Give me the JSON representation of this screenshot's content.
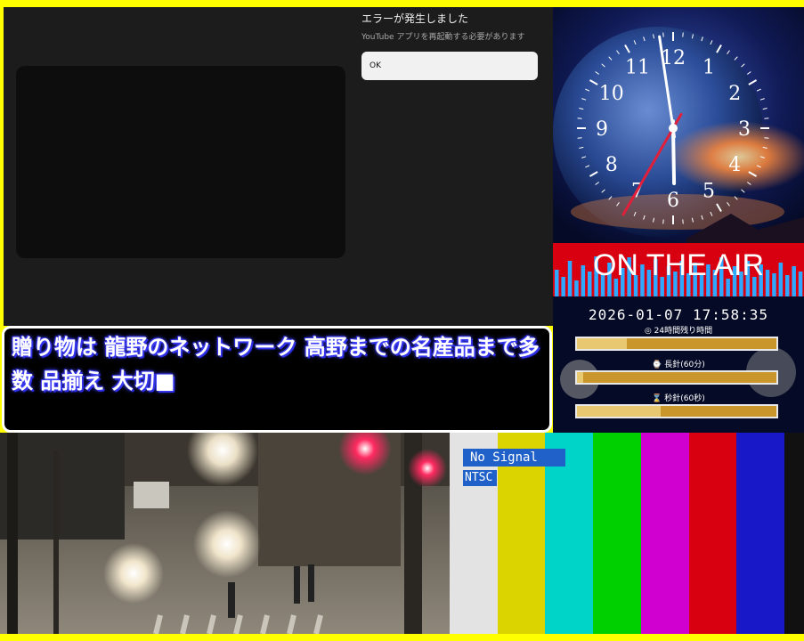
{
  "youtube_error": {
    "title": "エラーが発生しました",
    "message": "YouTube アプリを再起動する必要があります",
    "ok_label": "OK"
  },
  "clock_panel": {
    "numbers": [
      "12",
      "1",
      "2",
      "3",
      "4",
      "5",
      "6",
      "7",
      "8",
      "9",
      "10",
      "11"
    ],
    "time": {
      "hour": 17,
      "minute": 58,
      "second": 35
    },
    "on_air": "ON THE AIR",
    "datetime": "2026-01-07 17:58:35",
    "bars": [
      {
        "label": "24時間残り時間",
        "icon": "globe-icon",
        "progress": 0.25
      },
      {
        "label": "長針(60分)",
        "icon": "clock-icon",
        "progress": 0.03
      },
      {
        "label": "秒針(60秒)",
        "icon": "hourglass-icon",
        "progress": 0.42
      }
    ]
  },
  "ticker": {
    "text": "贈り物は 龍野のネットワーク 高野までの名産品まで多数 品揃え 大切■"
  },
  "camera": {
    "description_icon": "street-camera-feed"
  },
  "test_pattern": {
    "no_signal": "No Signal",
    "standard": "NTSC",
    "colors": [
      "#e3e3e3",
      "#dcd400",
      "#00d4c8",
      "#00d000",
      "#d000d0",
      "#d80010",
      "#1818c8"
    ]
  }
}
